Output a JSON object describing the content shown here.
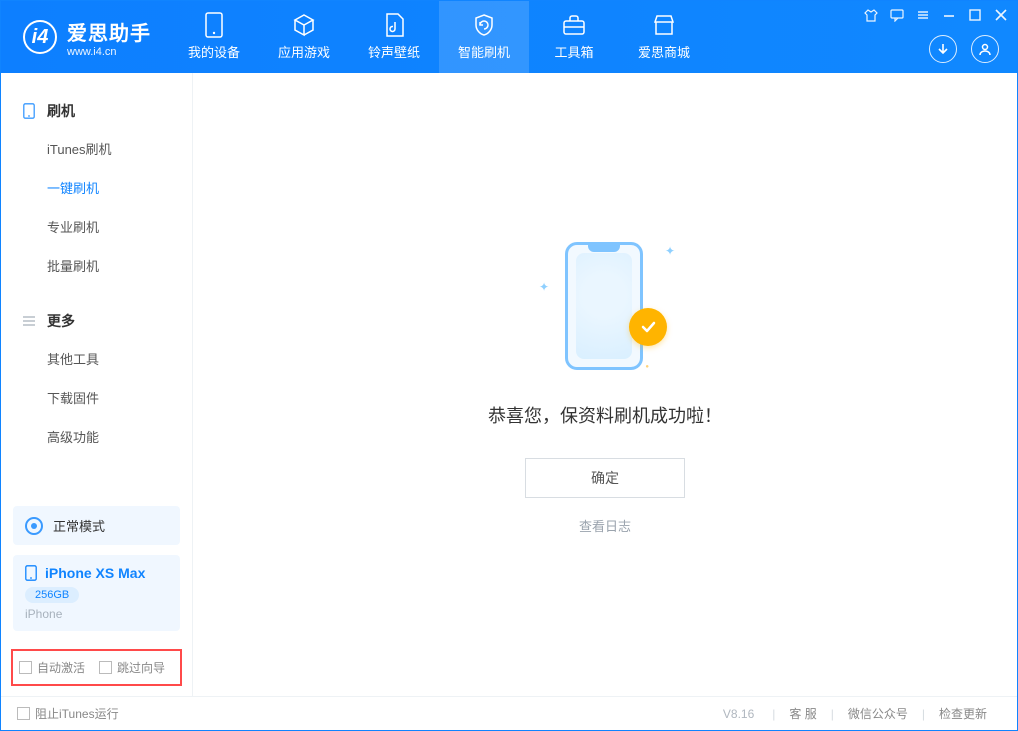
{
  "header": {
    "app_name": "爱思助手",
    "app_url": "www.i4.cn",
    "tabs": [
      {
        "label": "我的设备"
      },
      {
        "label": "应用游戏"
      },
      {
        "label": "铃声壁纸"
      },
      {
        "label": "智能刷机"
      },
      {
        "label": "工具箱"
      },
      {
        "label": "爱思商城"
      }
    ]
  },
  "sidebar": {
    "group_flash": {
      "title": "刷机",
      "items": [
        {
          "label": "iTunes刷机"
        },
        {
          "label": "一键刷机",
          "active": true
        },
        {
          "label": "专业刷机"
        },
        {
          "label": "批量刷机"
        }
      ]
    },
    "group_more": {
      "title": "更多",
      "items": [
        {
          "label": "其他工具"
        },
        {
          "label": "下载固件"
        },
        {
          "label": "高级功能"
        }
      ]
    },
    "mode": {
      "label": "正常模式"
    },
    "device": {
      "name": "iPhone XS Max",
      "storage": "256GB",
      "type": "iPhone"
    },
    "checks": {
      "auto_activate": "自动激活",
      "skip_guide": "跳过向导"
    }
  },
  "main": {
    "success_text": "恭喜您，保资料刷机成功啦！",
    "ok_button": "确定",
    "view_log": "查看日志"
  },
  "footer": {
    "stop_itunes": "阻止iTunes运行",
    "version": "V8.16",
    "links": {
      "support": "客 服",
      "wechat": "微信公众号",
      "update": "检查更新"
    }
  }
}
